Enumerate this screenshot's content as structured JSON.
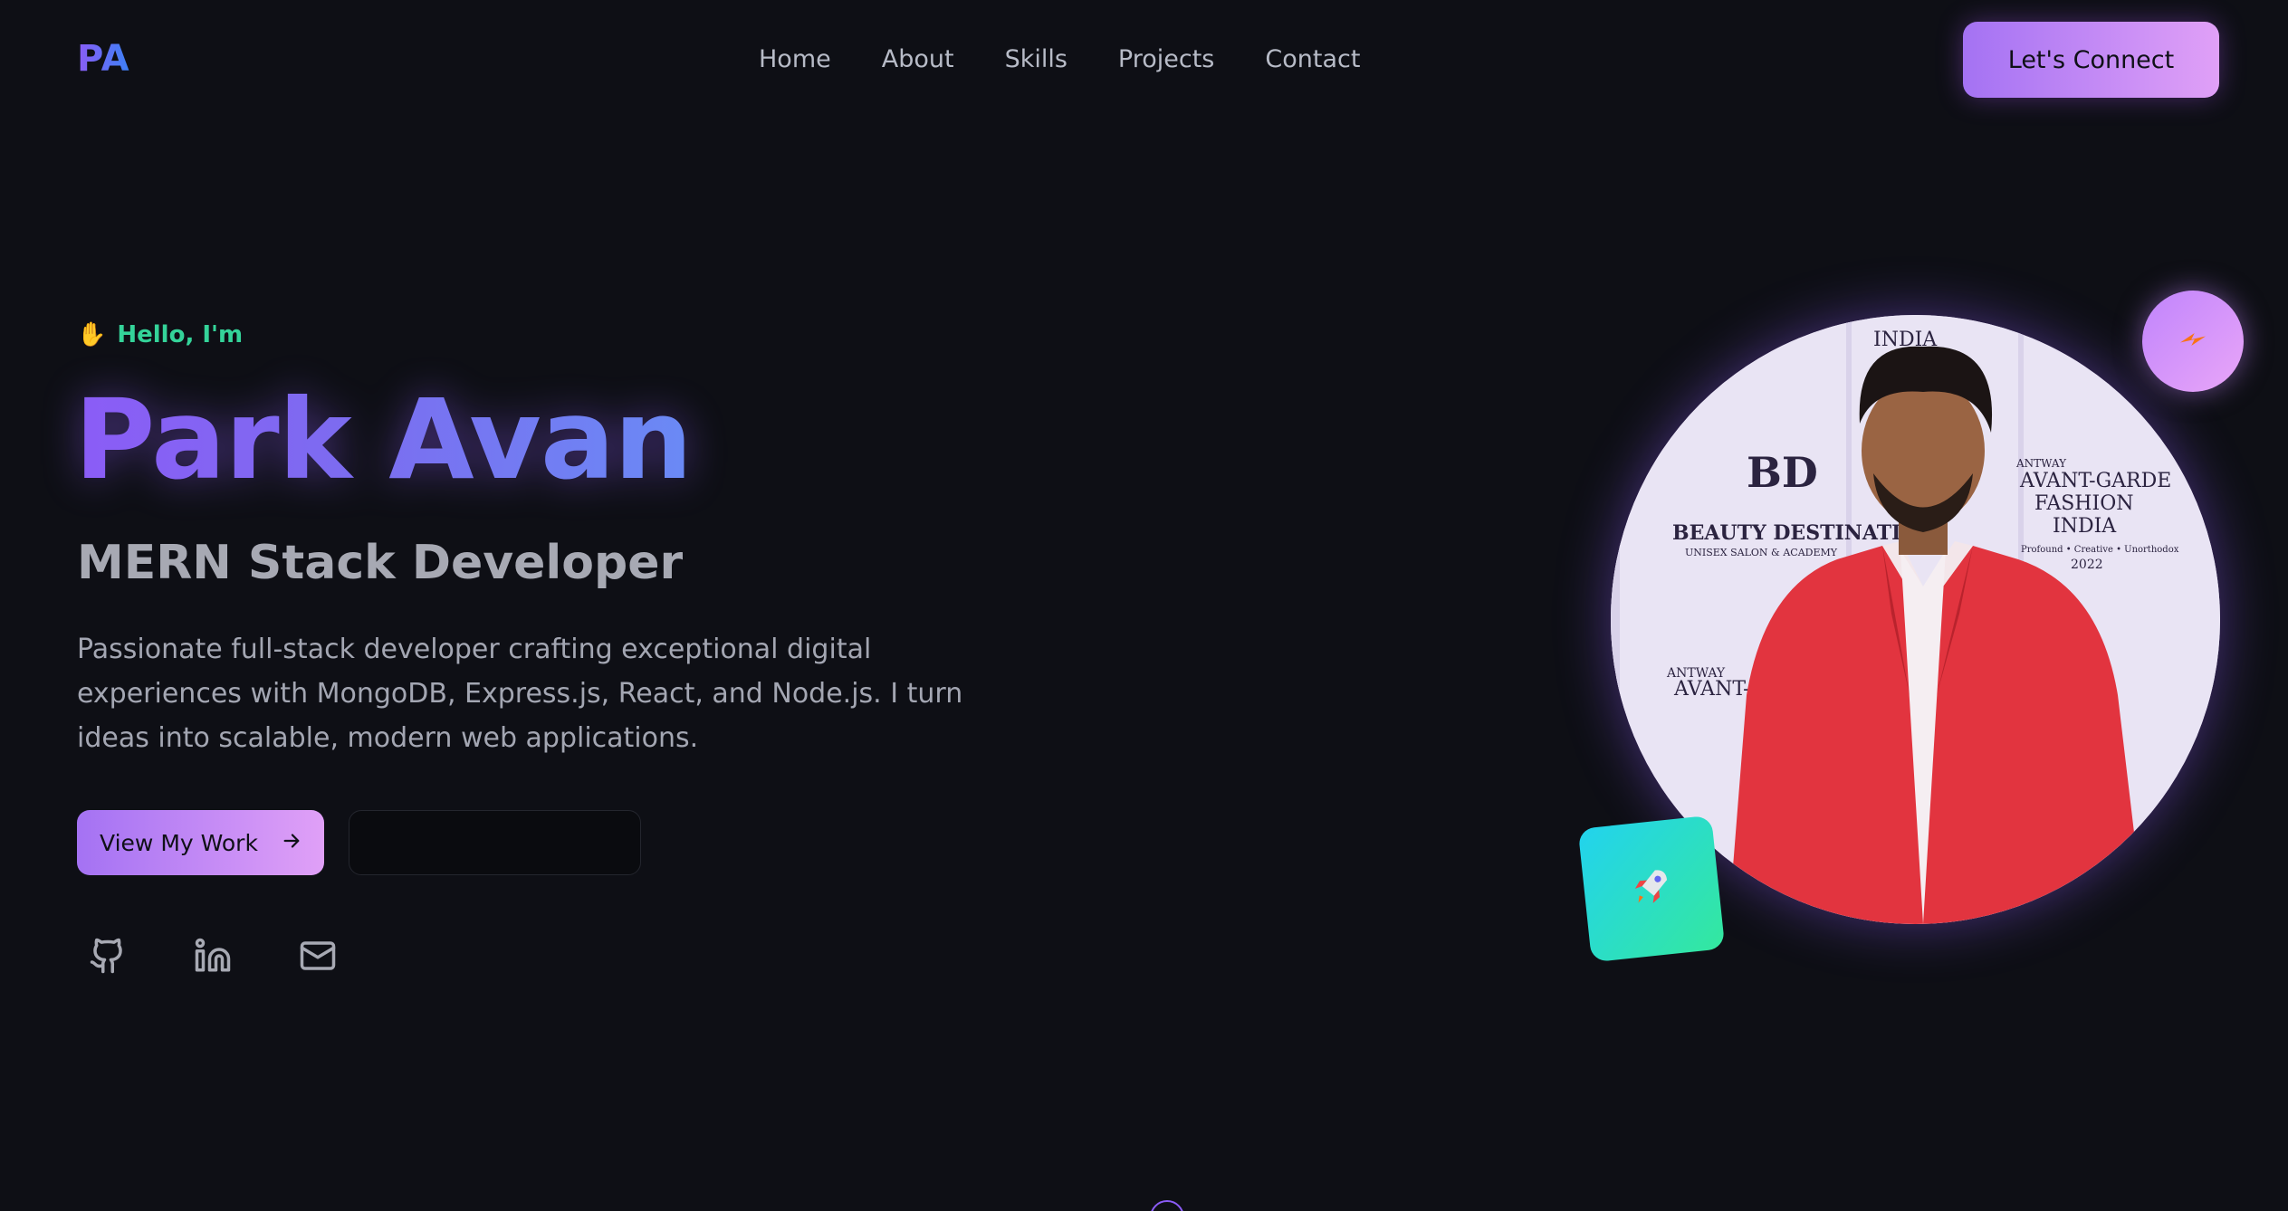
{
  "nav": {
    "logo": "PA",
    "links": [
      "Home",
      "About",
      "Skills",
      "Projects",
      "Contact"
    ],
    "cta_label": "Let's Connect"
  },
  "hero": {
    "greeting": "Hello, I'm",
    "name": "Park Avan",
    "role": "MERN Stack Developer",
    "description": "Passionate full-stack developer crafting exceptional digital experiences with MongoDB, Express.js, React, and Node.js. I turn ideas into scalable, modern web applications.",
    "primary_button": "View My Work",
    "secondary_button": ""
  },
  "socials": [
    {
      "icon": "github-icon"
    },
    {
      "icon": "linkedin-icon"
    },
    {
      "icon": "mail-icon"
    }
  ],
  "portrait": {
    "backdrop_texts": [
      "BEAUTY DESTINATION",
      "UNISEX SALON & ACADEMY",
      "ANTWAY",
      "AVANT-GARDE",
      "FASHION",
      "INDIA",
      "Profound • Creative • Unorthodox",
      "2022"
    ]
  },
  "badges": {
    "top": "zap-icon",
    "bottom": "rocket-icon"
  },
  "colors": {
    "background": "#0e0f15",
    "accent_purple": "#a472f3",
    "accent_pink": "#e0a0f7",
    "greeting_green": "#34d399",
    "teal": "#22d3ee"
  }
}
